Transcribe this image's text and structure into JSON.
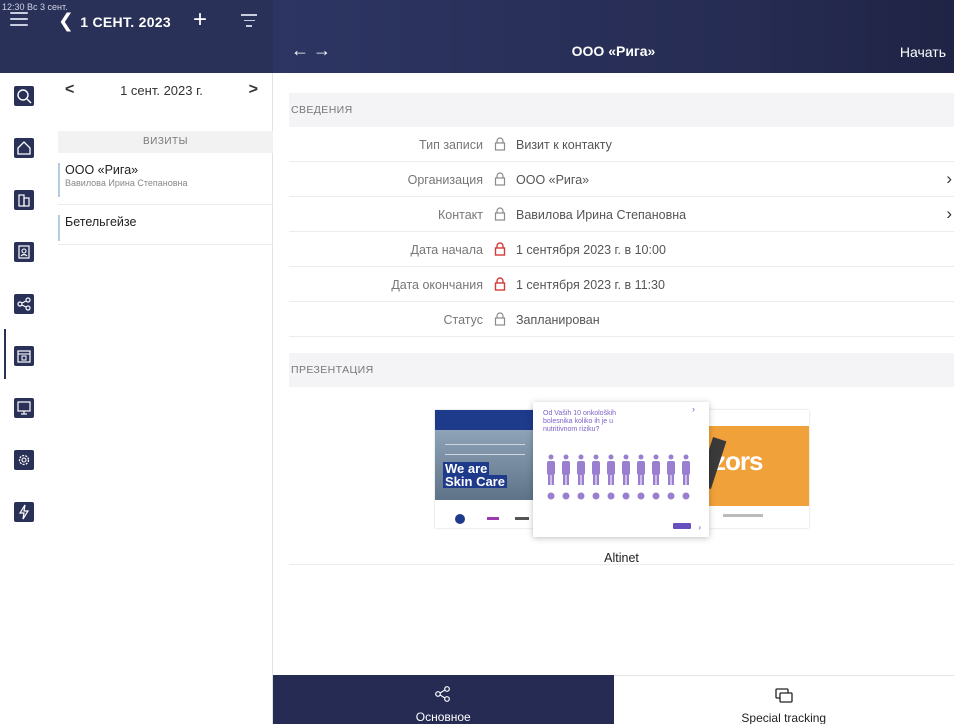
{
  "status": {
    "time": "12:30",
    "date": "Вс 3 сент."
  },
  "left_header": {
    "back_label": "1 СЕНТ. 2023"
  },
  "right_header": {
    "title": "ООО «Рига»",
    "action": "Начать"
  },
  "sidebar_icons": [
    "search-icon",
    "home-icon",
    "building-icon",
    "contacts-icon",
    "share-icon",
    "calendar-icon",
    "presentation-icon",
    "gear-icon",
    "bolt-icon"
  ],
  "day_nav": {
    "label": "1 сент. 2023 г."
  },
  "visits": {
    "header": "ВИЗИТЫ",
    "items": [
      {
        "title": "ООО «Рига»",
        "subtitle": "Вавилова Ирина Степановна"
      },
      {
        "title": "Бетельгейзе",
        "subtitle": ""
      }
    ]
  },
  "details": {
    "header": "СВЕДЕНИЯ",
    "rows": [
      {
        "key": "Тип записи",
        "value": "Визит к контакту",
        "lock_color": "#8a8a8a",
        "link": false
      },
      {
        "key": "Организация",
        "value": "ООО «Рига»",
        "lock_color": "#8a8a8a",
        "link": true
      },
      {
        "key": "Контакт",
        "value": "Вавилова Ирина Степановна",
        "lock_color": "#8a8a8a",
        "link": true
      },
      {
        "key": "Дата начала",
        "value": "1 сентября 2023 г. в 10:00",
        "lock_color": "#d63a3a",
        "link": false
      },
      {
        "key": "Дата окончания",
        "value": "1 сентября 2023 г. в 11:30",
        "lock_color": "#d63a3a",
        "link": false
      },
      {
        "key": "Статус",
        "value": "Запланирован",
        "lock_color": "#8a8a8a",
        "link": false
      }
    ]
  },
  "presentation": {
    "header": "ПРЕЗЕНТАЦИЯ",
    "name": "Altinet",
    "slide_left_text": [
      "We are",
      "Skin Care"
    ],
    "slide_mid_text": "Od Vaših 10 onkoloških bolesnika koliko ih je u nutritivnom riziku?",
    "slide_right_text": "zors"
  },
  "tabs": [
    {
      "label": "Основное",
      "active": true
    },
    {
      "label": "Special tracking",
      "active": false
    }
  ],
  "colors": {
    "header": "#2a3158",
    "accent_lock": "#d63a3a",
    "slide_purple": "#9a7fd1",
    "slide_orange": "#f0a13a"
  }
}
